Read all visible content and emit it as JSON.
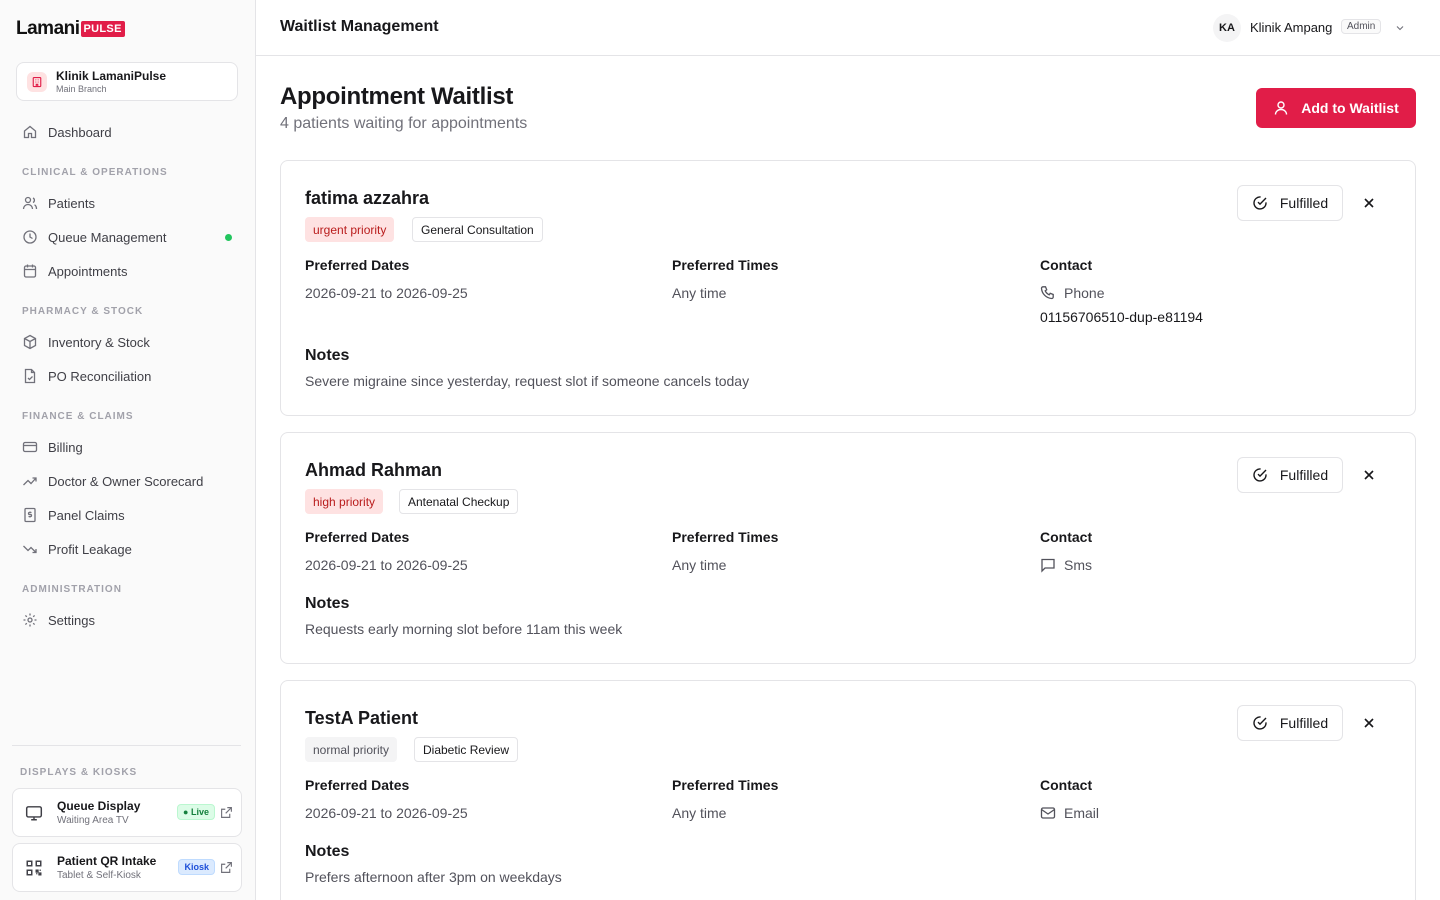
{
  "brand": {
    "name": "Lamani",
    "badge": "PULSE"
  },
  "clinic": {
    "name": "Klinik LamaniPulse",
    "branch": "Main Branch"
  },
  "nav": {
    "dashboard": "Dashboard",
    "sections": {
      "clinical": "CLINICAL & OPERATIONS",
      "pharmacy": "PHARMACY & STOCK",
      "finance": "FINANCE & CLAIMS",
      "admin": "ADMINISTRATION",
      "displays": "DISPLAYS & KIOSKS"
    },
    "patients": "Patients",
    "queue": "Queue Management",
    "appointments": "Appointments",
    "inventory": "Inventory & Stock",
    "po": "PO Reconciliation",
    "billing": "Billing",
    "scorecard": "Doctor & Owner Scorecard",
    "claims": "Panel Claims",
    "leakage": "Profit Leakage",
    "settings": "Settings"
  },
  "kiosks": [
    {
      "title": "Queue Display",
      "sub": "Waiting Area TV",
      "badge": "Live"
    },
    {
      "title": "Patient QR Intake",
      "sub": "Tablet & Self-Kiosk",
      "badge": "Kiosk"
    }
  ],
  "header": {
    "title": "Waitlist Management",
    "initials": "KA",
    "user": "Klinik Ampang",
    "role": "Admin"
  },
  "main": {
    "title": "Appointment Waitlist",
    "subtitle": "4 patients waiting for appointments",
    "add_button": "Add to Waitlist"
  },
  "labels": {
    "preferred_dates": "Preferred Dates",
    "preferred_times": "Preferred Times",
    "contact": "Contact",
    "notes": "Notes",
    "fulfilled": "Fulfilled"
  },
  "entries": [
    {
      "name": "fatima azzahra",
      "priority": "urgent priority",
      "type": "General Consultation",
      "dates": "2026-09-21 to 2026-09-25",
      "times": "Any time",
      "contact_method": "Phone",
      "contact_value": "01156706510-dup-e81194",
      "notes": "Severe migraine since yesterday, request slot if someone cancels today"
    },
    {
      "name": "Ahmad Rahman",
      "priority": "high priority",
      "type": "Antenatal Checkup",
      "dates": "2026-09-21 to 2026-09-25",
      "times": "Any time",
      "contact_method": "Sms",
      "notes": "Requests early morning slot before 11am this week"
    },
    {
      "name": "TestA Patient",
      "priority": "normal priority",
      "type": "Diabetic Review",
      "dates": "2026-09-21 to 2026-09-25",
      "times": "Any time",
      "contact_method": "Email",
      "notes": "Prefers afternoon after 3pm on weekdays"
    }
  ]
}
